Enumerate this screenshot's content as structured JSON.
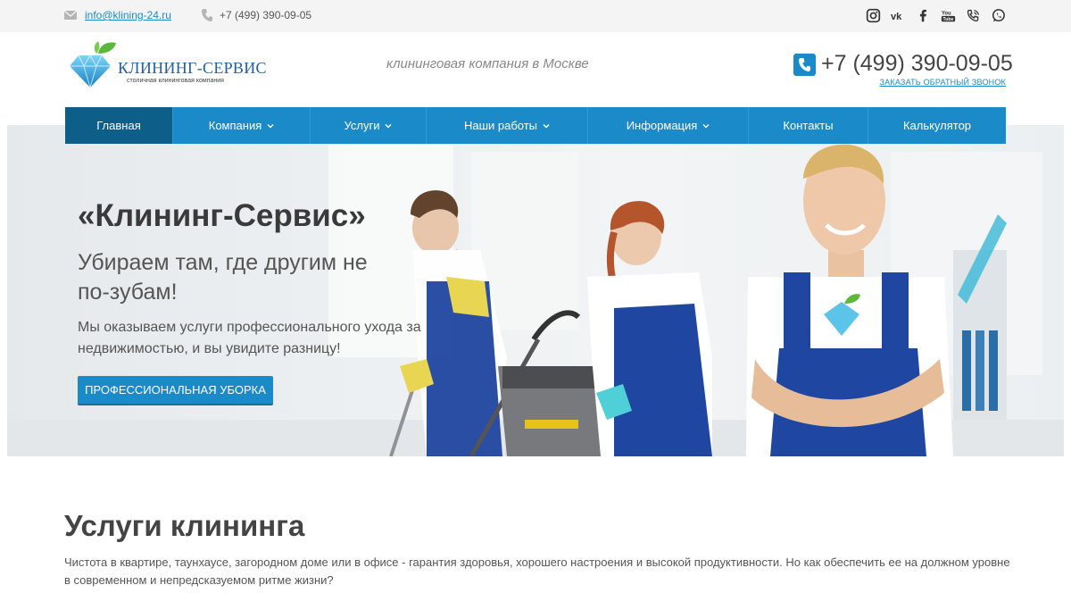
{
  "topbar": {
    "email": "info@klining-24.ru",
    "phone": "+7 (499) 390-09-05",
    "socials": [
      "instagram-icon",
      "vk-icon",
      "facebook-icon",
      "youtube-icon",
      "viber-icon",
      "whatsapp-icon"
    ]
  },
  "header": {
    "logo_brand": "КЛИНИНГ-СЕРВИС",
    "logo_sub": "столичная клининговая компания",
    "tagline": "клининговая компания в Москве",
    "phone": "+7 (499) 390-09-05",
    "callback": "ЗАКАЗАТЬ ОБРАТНЫЙ ЗВОНОК"
  },
  "nav": {
    "items": [
      {
        "label": "Главная",
        "active": true,
        "dropdown": false
      },
      {
        "label": "Компания",
        "active": false,
        "dropdown": true
      },
      {
        "label": "Услуги",
        "active": false,
        "dropdown": true
      },
      {
        "label": "Наши работы",
        "active": false,
        "dropdown": true
      },
      {
        "label": "Информация",
        "active": false,
        "dropdown": true
      },
      {
        "label": "Контакты",
        "active": false,
        "dropdown": false
      },
      {
        "label": "Калькулятор",
        "active": false,
        "dropdown": false
      }
    ]
  },
  "hero": {
    "title": "«Клининг-Сервис»",
    "subtitle": "Убираем там, где другим не по-зубам!",
    "text": "Мы оказываем услуги профессионального ухода за недвижимостью, и вы увидите разницу!",
    "button": "ПРОФЕССИОНАЛЬНАЯ УБОРКА"
  },
  "services": {
    "title": "Услуги клининга",
    "text": "Чистота в квартире, таунхаусе, загородном доме или в офисе - гарантия здоровья, хорошего настроения и высокой продуктивности. Но как обеспечить ее на должном уровне в современном и непредсказуемом ритме жизни?"
  },
  "colors": {
    "accent": "#1a8ac8",
    "nav_active": "#0e5e8a",
    "overall_blue": "#1f3f99"
  }
}
